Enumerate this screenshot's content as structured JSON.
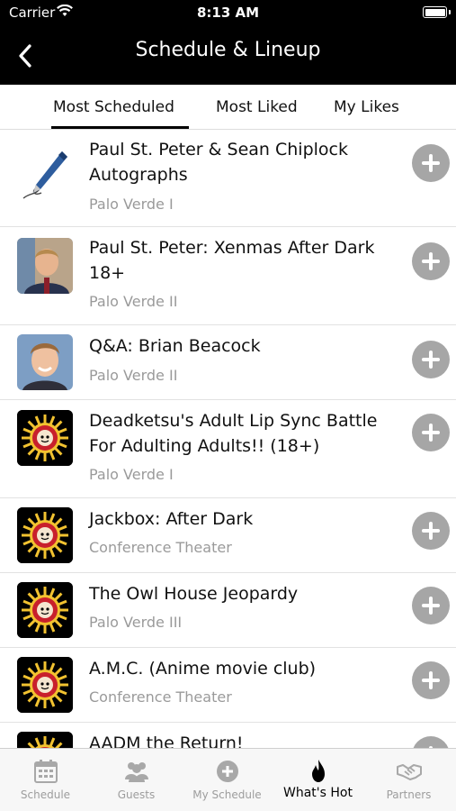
{
  "status": {
    "carrier": "Carrier",
    "time": "8:13 AM"
  },
  "nav": {
    "title": "Schedule & Lineup"
  },
  "tabs": [
    {
      "label": "Most Scheduled",
      "active": true
    },
    {
      "label": "Most Liked",
      "active": false
    },
    {
      "label": "My Likes",
      "active": false
    }
  ],
  "events": [
    {
      "title": "Paul St. Peter & Sean Chiplock Autographs",
      "venue": "Palo Verde I",
      "thumb": "pen-icon"
    },
    {
      "title": "Paul St. Peter: Xenmas After Dark 18+",
      "venue": "Palo Verde II",
      "thumb": "person-photo"
    },
    {
      "title": "Q&A: Brian Beacock",
      "venue": "Palo Verde II",
      "thumb": "person-photo"
    },
    {
      "title": " Deadketsu's Adult Lip Sync Battle For Adulting Adults!! (18+)",
      "venue": "Palo Verde I",
      "thumb": "convention-logo"
    },
    {
      "title": " Jackbox: After Dark",
      "venue": "Conference Theater",
      "thumb": "convention-logo"
    },
    {
      "title": " The Owl House Jeopardy",
      "venue": "Palo Verde III",
      "thumb": "convention-logo"
    },
    {
      "title": "A.M.C. (Anime movie club)",
      "venue": "Conference Theater",
      "thumb": "convention-logo"
    },
    {
      "title": "AADM the Return!",
      "venue": "",
      "thumb": "convention-logo"
    }
  ],
  "tabbar": [
    {
      "label": "Schedule",
      "icon": "calendar-icon"
    },
    {
      "label": "Guests",
      "icon": "guests-icon"
    },
    {
      "label": "My Schedule",
      "icon": "plus-circle-icon"
    },
    {
      "label": "What's Hot",
      "icon": "flame-icon",
      "active": true
    },
    {
      "label": "Partners",
      "icon": "handshake-icon"
    }
  ],
  "colors": {
    "nav_bg": "#000000",
    "add_button": "#a6a6a6",
    "venue_text": "#9a9a9a"
  }
}
